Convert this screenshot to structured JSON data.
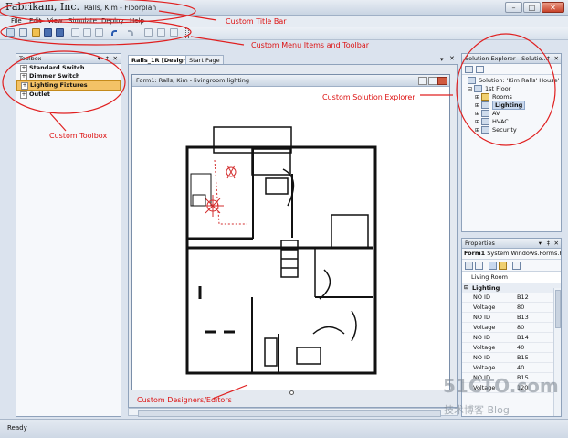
{
  "title_bar": {
    "brand": "Fabrikam, Inc.",
    "document": "Ralls, Kim - Floorplan"
  },
  "window_controls": {
    "minimize": "–",
    "maximize": "□",
    "close": "✕"
  },
  "menu": [
    "File",
    "Edit",
    "View",
    "Simulate",
    "Deploy",
    "Help"
  ],
  "toolbox": {
    "title": "Toolbox",
    "items": [
      "Standard Switch",
      "Dimmer Switch",
      "Lighting Fixtures",
      "Outlet"
    ],
    "selected": "Lighting Fixtures"
  },
  "tabs": [
    "Ralls_1R [Design]*",
    "Start Page"
  ],
  "designer": {
    "form_title": "Form1: Ralls, Kim - livingroom lighting"
  },
  "solution_explorer": {
    "title": "Solution Explorer - Solutio...",
    "solution": "Solution: 'Kim Ralls' House'",
    "floor": "1st Floor",
    "items": [
      "Rooms",
      "Lighting",
      "AV",
      "HVAC",
      "Security"
    ],
    "selected": "Lighting"
  },
  "properties": {
    "title": "Properties",
    "object": "Form1",
    "object_type": "System.Windows.Forms.Fo",
    "living_room": "Living Room",
    "category": "Lighting",
    "rows": [
      {
        "key": "NO ID",
        "value": "B12"
      },
      {
        "key": "Voltage",
        "value": "80"
      },
      {
        "key": "NO ID",
        "value": "B13"
      },
      {
        "key": "Voltage",
        "value": "80"
      },
      {
        "key": "NO ID",
        "value": "B14"
      },
      {
        "key": "Voltage",
        "value": "40"
      },
      {
        "key": "NO ID",
        "value": "B15"
      },
      {
        "key": "Voltage",
        "value": "40"
      },
      {
        "key": "NO ID",
        "value": "B15"
      },
      {
        "key": "Voltage",
        "value": "120"
      }
    ]
  },
  "status": {
    "text": "Ready"
  },
  "annotations": {
    "title_bar": "Custom Title Bar",
    "menu_toolbar": "Custom Menu Items and Toolbar",
    "toolbox": "Custom Toolbox",
    "solution_explorer": "Custom Solution Explorer",
    "designers": "Custom Designers/Editors"
  },
  "watermark": {
    "site": "51CTO.com",
    "blog": "技术博客  Blog"
  },
  "colors": {
    "accent": "#f3c266",
    "annotation": "#dd1111",
    "frame": "#8fa2bb"
  }
}
